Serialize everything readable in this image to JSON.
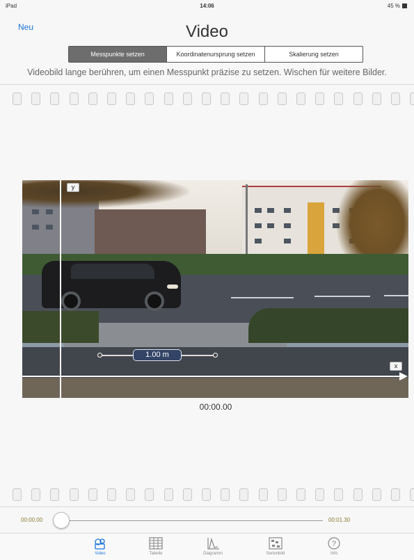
{
  "status": {
    "device": "iPad",
    "time": "14:06",
    "battery": "45 %"
  },
  "nav": {
    "new_label": "Neu",
    "title": "Video"
  },
  "segments": [
    {
      "label": "Messpunkte setzen",
      "active": true
    },
    {
      "label": "Koordinatenursprung setzen",
      "active": false
    },
    {
      "label": "Skalierung setzen",
      "active": false
    }
  ],
  "hint": "Videobild lange berühren, um einen Messpunkt präzise zu setzen. Wischen für weitere Bilder.",
  "overlay": {
    "y_label": "y",
    "x_label": "x",
    "scale_label": "1.00 m"
  },
  "timecode": "00:00.00",
  "timeline": {
    "start": "00:00.00",
    "end": "00:01.30"
  },
  "tabs": [
    {
      "label": "Video",
      "icon": "video-icon",
      "active": true
    },
    {
      "label": "Tabelle",
      "icon": "table-icon",
      "active": false
    },
    {
      "label": "Diagramm",
      "icon": "chart-icon",
      "active": false
    },
    {
      "label": "Serienbild",
      "icon": "series-image-icon",
      "active": false
    },
    {
      "label": "Info",
      "icon": "info-icon",
      "active": false
    }
  ],
  "colors": {
    "accent": "#1a73d9",
    "segment_active": "#6d6d6d",
    "timeline_text": "#8a7a33"
  }
}
